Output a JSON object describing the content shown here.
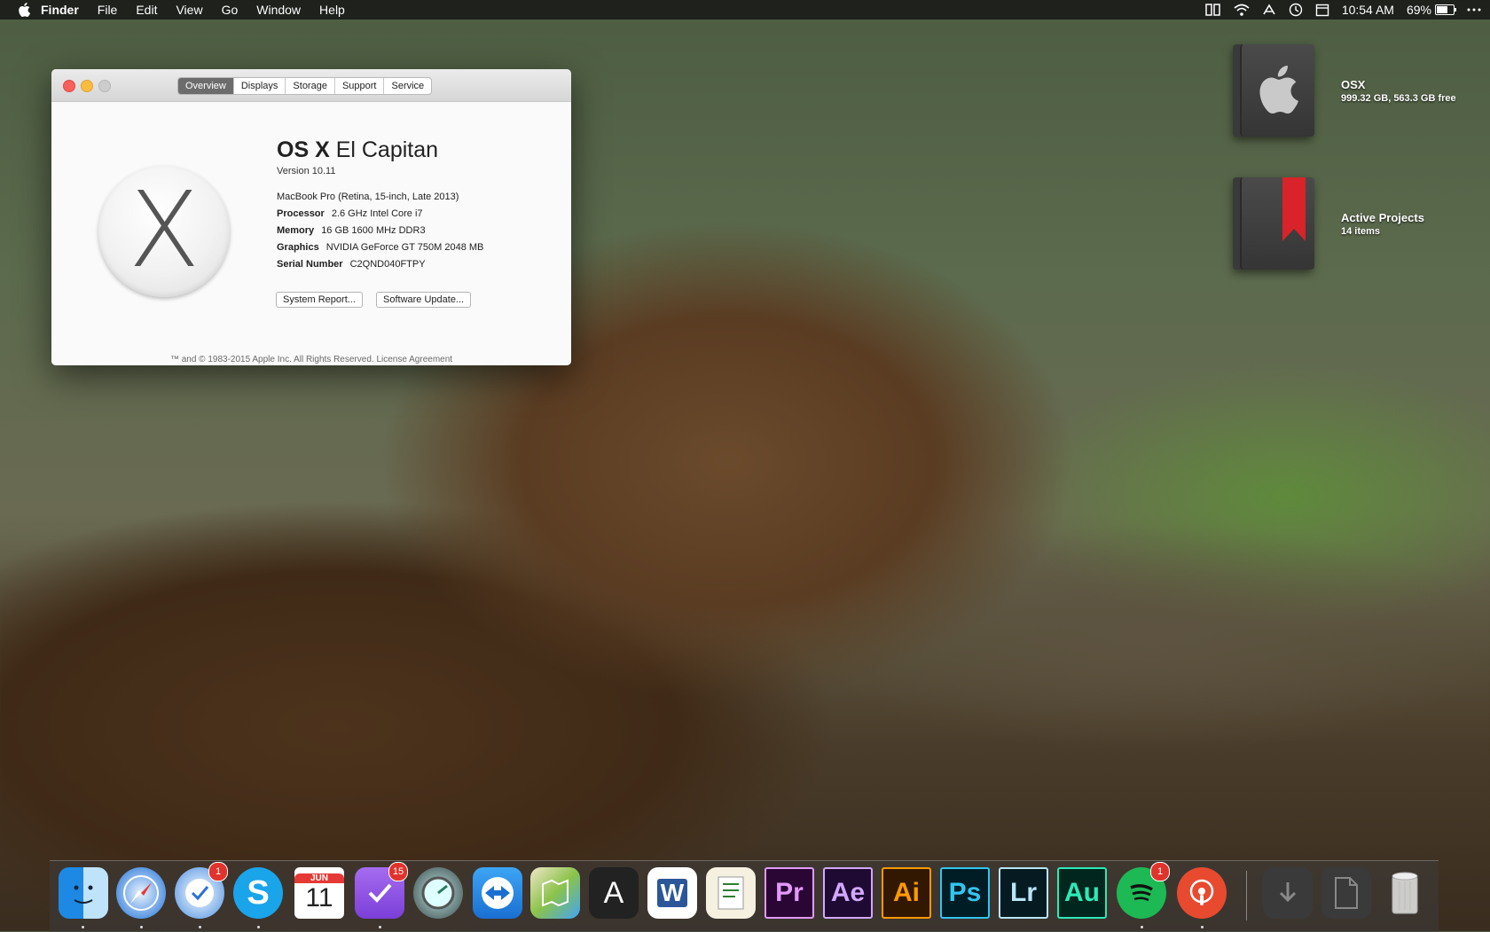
{
  "menubar": {
    "apple_icon": "apple-logo",
    "items": [
      "Finder",
      "File",
      "Edit",
      "View",
      "Go",
      "Window",
      "Help"
    ],
    "time": "10:54 AM",
    "battery_percent": "69%",
    "battery_level": 0.69,
    "status_icons": [
      "airplay-icon",
      "wifi-icon",
      "timemachine-icon",
      "calendar-status-icon",
      "notification-center-icon"
    ]
  },
  "about_window": {
    "tabs": [
      "Overview",
      "Displays",
      "Storage",
      "Support",
      "Service"
    ],
    "active_tab": "Overview",
    "logo_letter": "X",
    "os_name_bold": "OS X",
    "os_name_rest": "El Capitan",
    "version": "Version 10.11",
    "model": "MacBook Pro (Retina, 15-inch, Late 2013)",
    "specs": [
      {
        "key": "Processor",
        "value": "2.6 GHz Intel Core i7"
      },
      {
        "key": "Memory",
        "value": "16 GB 1600 MHz DDR3"
      },
      {
        "key": "Graphics",
        "value": "NVIDIA GeForce GT 750M 2048 MB"
      },
      {
        "key": "Serial Number",
        "value": "C2QND040FTPY"
      }
    ],
    "buttons": {
      "system_report": "System Report...",
      "software_update": "Software Update..."
    },
    "footer": "™ and © 1983-2015 Apple Inc. All Rights Reserved. License Agreement"
  },
  "desktop": {
    "items": [
      {
        "name": "OSX",
        "detail": "999.32 GB, 563.3 GB free",
        "icon": "apple-drive-icon"
      },
      {
        "name": "Active Projects",
        "detail": "14 items",
        "icon": "bookmark-folder-icon"
      }
    ]
  },
  "dock": {
    "apps": [
      {
        "name": "Finder",
        "icon": "finder-icon"
      },
      {
        "name": "Safari",
        "icon": "safari-icon"
      },
      {
        "name": "Airmail",
        "icon": "mail-icon",
        "badge": "1"
      },
      {
        "name": "Skype",
        "icon": "skype-icon",
        "label": "S"
      },
      {
        "name": "Calendar",
        "icon": "calendar-icon",
        "month": "JUN",
        "day": "11"
      },
      {
        "name": "OmniFocus",
        "icon": "checkmark-icon",
        "badge": "15"
      },
      {
        "name": "iStat",
        "icon": "gauge-icon"
      },
      {
        "name": "TeamViewer",
        "icon": "teamviewer-icon"
      },
      {
        "name": "Maps",
        "icon": "maps-icon"
      },
      {
        "name": "Font App",
        "icon": "font-icon",
        "label": "A"
      },
      {
        "name": "Word",
        "icon": "word-icon",
        "label": "W"
      },
      {
        "name": "Script Editor",
        "icon": "script-icon"
      },
      {
        "name": "Premiere",
        "icon": "premiere-icon",
        "label": "Pr"
      },
      {
        "name": "After Effects",
        "icon": "aftereffects-icon",
        "label": "Ae"
      },
      {
        "name": "Illustrator",
        "icon": "illustrator-icon",
        "label": "Ai"
      },
      {
        "name": "Photoshop",
        "icon": "photoshop-icon",
        "label": "Ps"
      },
      {
        "name": "Lightroom",
        "icon": "lightroom-icon",
        "label": "Lr"
      },
      {
        "name": "Audition",
        "icon": "audition-icon",
        "label": "Au"
      },
      {
        "name": "Spotify",
        "icon": "spotify-icon",
        "badge": "1"
      },
      {
        "name": "Podcasts",
        "icon": "podcast-icon"
      },
      {
        "name": "Downloads",
        "icon": "downloads-icon"
      },
      {
        "name": "Documents",
        "icon": "document-icon"
      },
      {
        "name": "Trash",
        "icon": "trash-icon"
      }
    ]
  }
}
